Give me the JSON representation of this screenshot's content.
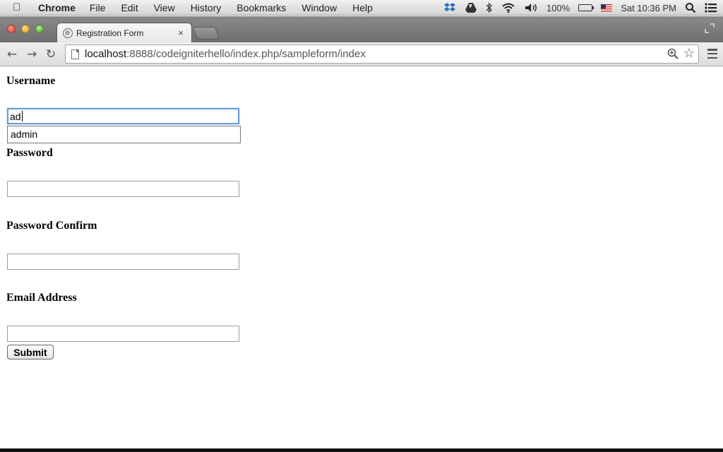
{
  "menubar": {
    "app_name": "Chrome",
    "items": [
      "File",
      "Edit",
      "View",
      "History",
      "Bookmarks",
      "Window",
      "Help"
    ],
    "battery_text": "100%",
    "clock": "Sat 10:36 PM"
  },
  "tab": {
    "title": "Registration Form",
    "close_glyph": "×"
  },
  "omnibox": {
    "url_host": "localhost",
    "url_rest": ":8888/codeigniterhello/index.php/sampleform/index"
  },
  "form": {
    "username_label": "Username",
    "username_value": "ad",
    "autocomplete_suggestion": "admin",
    "password_label": "Password",
    "password_value": "",
    "password_confirm_label": "Password Confirm",
    "password_confirm_value": "",
    "email_label": "Email Address",
    "email_value": "",
    "submit_label": "Submit"
  },
  "icons": {
    "apple": "apple-icon",
    "dropbox": "dropbox-icon",
    "drive": "google-drive-icon",
    "bluetooth": "bluetooth-icon",
    "wifi": "wifi-icon",
    "volume": "volume-icon",
    "battery": "battery-icon",
    "flag": "us-flag-icon",
    "spotlight": "spotlight-search-icon",
    "notifications": "notification-center-icon"
  },
  "colors": {
    "focus_ring": "#6b9bd8"
  }
}
